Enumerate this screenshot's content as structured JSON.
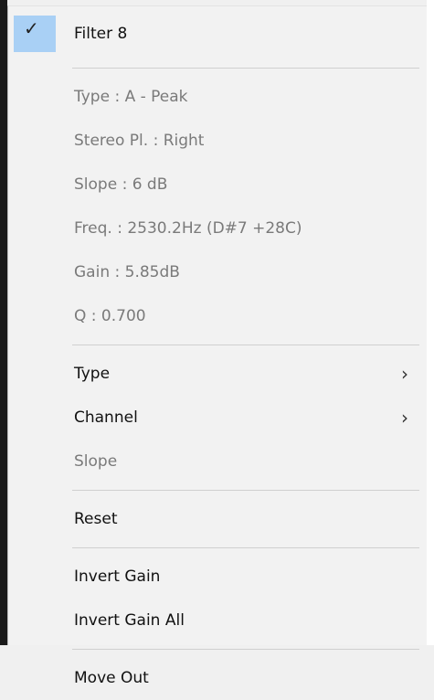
{
  "menu": {
    "header": {
      "label": "Filter 8",
      "checked": true
    },
    "info": [
      "Type : A - Peak",
      "Stereo Pl. : Right",
      "Slope :  6 dB",
      "Freq. : 2530.2Hz (D#7 +28C)",
      "Gain : 5.85dB",
      "Q : 0.700"
    ],
    "type_label": "Type",
    "channel_label": "Channel",
    "slope_label": "Slope",
    "reset_label": "Reset",
    "invert_gain_label": "Invert Gain",
    "invert_gain_all_label": "Invert Gain All",
    "move_out_label": "Move Out",
    "submenu_glyph": "›",
    "check_glyph": "✓"
  },
  "colors": {
    "highlight": "#a9d0f5",
    "disabled_text": "#7a7a7a",
    "text": "#111111"
  }
}
